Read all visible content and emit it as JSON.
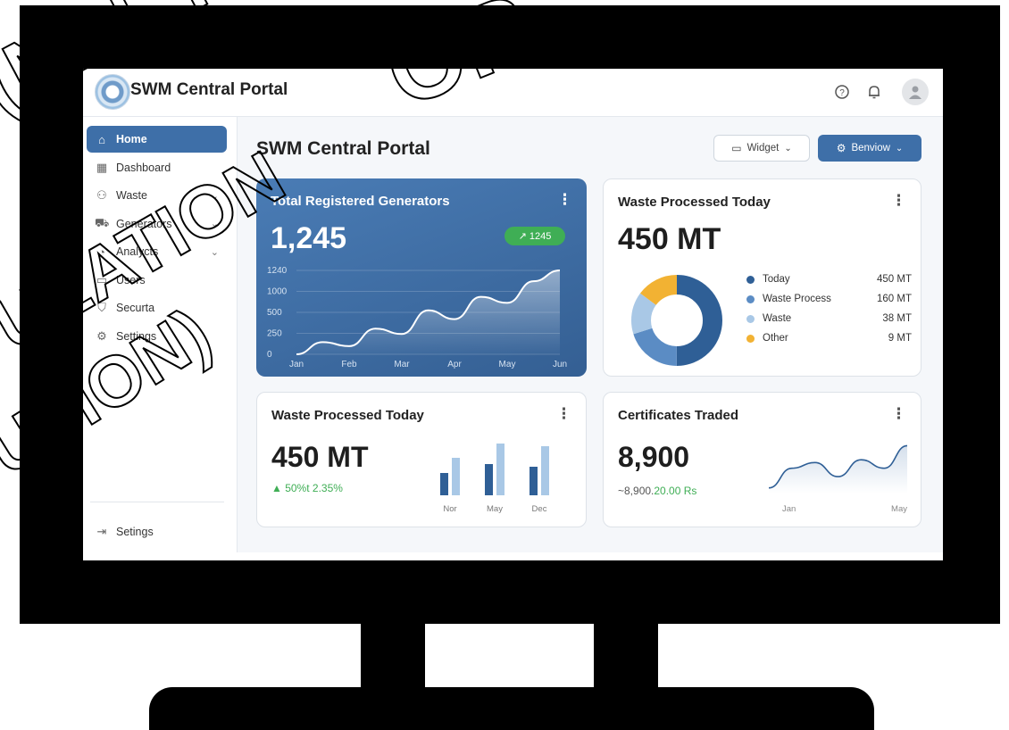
{
  "app": {
    "title": "SWM Central Portal"
  },
  "header": {
    "icons": [
      "help-icon",
      "bell-icon",
      "user-avatar-icon"
    ]
  },
  "sidebar": {
    "items": [
      {
        "label": "Home",
        "icon": "home-icon",
        "active": true,
        "has_chevron": false
      },
      {
        "label": "Dashboard",
        "icon": "grid-icon",
        "active": false,
        "has_chevron": false
      },
      {
        "label": "Waste",
        "icon": "users-icon",
        "active": false,
        "has_chevron": true
      },
      {
        "label": "Generators",
        "icon": "truck-icon",
        "active": false,
        "has_chevron": true
      },
      {
        "label": "Analycts",
        "icon": "chart-icon",
        "active": false,
        "has_chevron": true
      },
      {
        "label": "Users",
        "icon": "calendar-icon",
        "active": false,
        "has_chevron": false
      },
      {
        "label": "Securta",
        "icon": "shield-icon",
        "active": false,
        "has_chevron": false
      },
      {
        "label": "Settings",
        "icon": "gear-icon",
        "active": false,
        "has_chevron": false
      }
    ],
    "footer": {
      "label": "Setings",
      "icon": "logout-icon"
    }
  },
  "main": {
    "title": "SWM Central Portal",
    "widget_button": "Widget",
    "primary_button": "Benviow"
  },
  "cards": {
    "generators": {
      "title": "Total Registered Generators",
      "value": "1,245",
      "badge": "↗ 1245",
      "y_ticks": [
        "1240",
        "1000",
        "500",
        "250",
        "0"
      ]
    },
    "waste_today": {
      "title": "Waste Processed Today",
      "value": "450 MT",
      "legend": [
        {
          "label": "Today",
          "value": "450 MT",
          "color": "#2f5f96"
        },
        {
          "label": "Waste Process",
          "value": "160 MT",
          "color": "#5b8cc4"
        },
        {
          "label": "Waste",
          "value": "38 MT",
          "color": "#a9c8e6"
        },
        {
          "label": "Other",
          "value": "9 MT",
          "color": "#f2b233"
        }
      ]
    },
    "waste_bar": {
      "title": "Waste Processed Today",
      "value": "450 MT",
      "change": "▲ 50%t 2.35%"
    },
    "certificates": {
      "title": "Certificates Traded",
      "value": "8,900",
      "sub_prefix": "~8,900.",
      "sub_suffix": "20.00 Rs"
    }
  },
  "chart_data": [
    {
      "type": "area",
      "title": "Total Registered Generators",
      "categories": [
        "Jan",
        "Feb",
        "Mar",
        "Apr",
        "May",
        "Jun"
      ],
      "x_points": [
        0,
        0.5,
        1,
        1.5,
        2,
        2.5,
        3,
        3.5,
        4,
        4.5,
        5
      ],
      "values": [
        0,
        180,
        120,
        380,
        300,
        650,
        520,
        850,
        760,
        1080,
        1240
      ],
      "ylim": [
        0,
        1240
      ],
      "y_ticks": [
        "1240",
        "1000",
        "500",
        "250",
        "0"
      ]
    },
    {
      "type": "pie",
      "title": "Waste Processed Today",
      "labels": [
        "Today",
        "Waste Process",
        "Waste",
        "Other"
      ],
      "values": [
        50,
        20,
        15,
        15
      ],
      "colors": [
        "#2f5f96",
        "#5b8cc4",
        "#a9c8e6",
        "#f2b233"
      ]
    },
    {
      "type": "bar",
      "title": "Waste Processed Today",
      "categories": [
        "Nor",
        "May",
        "Dec"
      ],
      "series": [
        {
          "values": [
            25,
            35,
            32
          ]
        },
        {
          "values": [
            42,
            58,
            55
          ]
        }
      ],
      "ylim": [
        0,
        60
      ],
      "colors": [
        "#2f5f96",
        "#a9c8e6"
      ]
    },
    {
      "type": "line",
      "title": "Certificates Traded",
      "categories": [
        "Jan",
        "May"
      ],
      "x": [
        0,
        1,
        2,
        3,
        4,
        5,
        6
      ],
      "values": [
        10,
        45,
        55,
        30,
        60,
        45,
        85
      ],
      "ylim": [
        0,
        100
      ]
    }
  ],
  "watermark": {
    "lines": [
      "(NAL RE",
      "OR",
      "ULATION",
      "UTION)"
    ]
  }
}
